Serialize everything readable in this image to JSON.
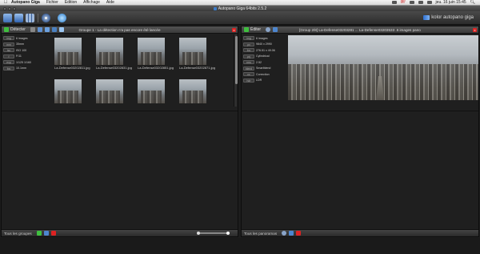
{
  "menubar": {
    "apple": "",
    "items": [
      "Autopano Giga",
      "Fichier",
      "Edition",
      "Affichage",
      "Aide"
    ],
    "memory_line1": "MEM",
    "memory_line2": "CPU",
    "clock": "jeu. 16 juin  15:45"
  },
  "window": {
    "title": "Autopano Giga 64bits 2.5.2"
  },
  "toolbar": {
    "brand": "kolor autopano giga",
    "colors": {
      "accent": "#3c7cc9",
      "green": "#3fbf3f",
      "red": "#d22"
    }
  },
  "left_panel": {
    "button_label": "Détecter",
    "title": "Groupe 1 - La détection n'a pas encore été lancée",
    "info_rows": [
      {
        "k": "img",
        "v": "6 images"
      },
      {
        "k": "mm",
        "v": "35mm"
      },
      {
        "k": "iso",
        "v": "ISO 100"
      },
      {
        "k": "f",
        "v": "F/11"
      },
      {
        "k": "exp",
        "v": "1/125 1/160"
      },
      {
        "k": "fov",
        "v": "10.1mm"
      }
    ],
    "thumbnails": [
      "La-Defense03202811.jpg",
      "La-Defense03202831.jpg",
      "La-Defense03202851.jpg",
      "La-Defense03202871.jpg",
      "",
      "",
      "",
      ""
    ],
    "footer_label": "Tous les groupes"
  },
  "right_panel": {
    "button_label": "Éditer",
    "title": "[Group 2/8] La-Defense03203281 ... La-Defense03203533 .6 images pano",
    "info_rows": [
      {
        "k": "img",
        "v": "6 images"
      },
      {
        "k": "px",
        "v": "9840 x 2990"
      },
      {
        "k": "fov",
        "v": "276.51 x 49.06"
      },
      {
        "k": "prj",
        "v": "Cylindrical"
      },
      {
        "k": "rms",
        "v": "2.52"
      },
      {
        "k": "blend",
        "v": "Smartblend"
      },
      {
        "k": "cc",
        "v": "Correction"
      },
      {
        "k": "hdr",
        "v": "LDR"
      }
    ],
    "footer_label": "Tous les panoramas"
  }
}
